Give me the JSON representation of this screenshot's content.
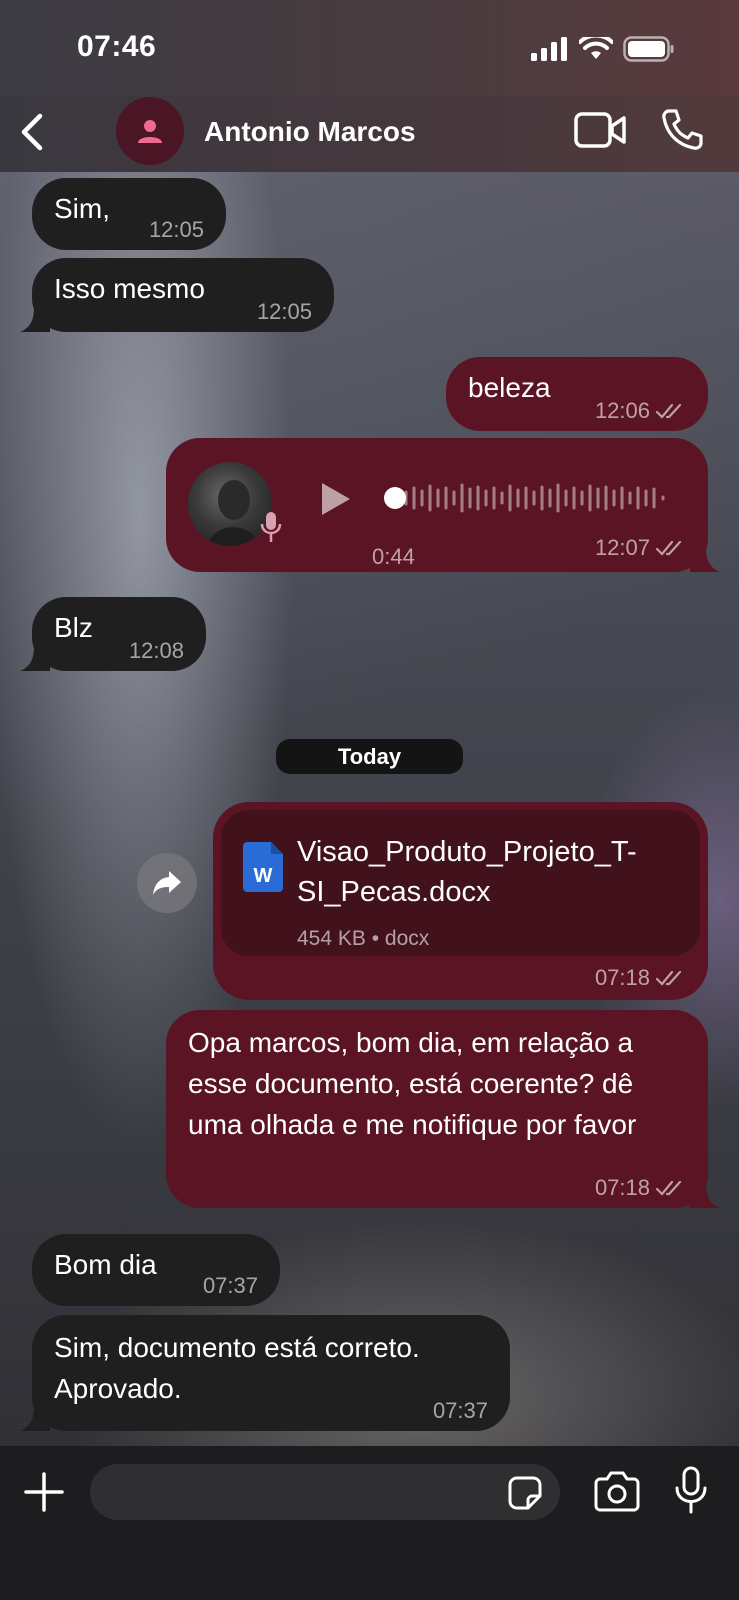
{
  "status_bar": {
    "time": "07:46"
  },
  "header": {
    "contact_name": "Antonio Marcos"
  },
  "messages": [
    {
      "text": "Sim,",
      "time": "12:05"
    },
    {
      "text": "Isso mesmo",
      "time": "12:05"
    },
    {
      "text": "beleza",
      "time": "12:06"
    },
    {
      "duration": "0:44",
      "time": "12:07"
    },
    {
      "text": "Blz",
      "time": "12:08"
    },
    {
      "file_name": "Visao_Produto_Projeto_T-SI_Pecas.docx",
      "file_info": "454 KB • docx",
      "time": "07:18"
    },
    {
      "text": "Opa marcos, bom dia, em relação a esse documento, está coerente? dê uma olhada e me notifique por favor",
      "time": "07:18"
    },
    {
      "text": "Bom dia",
      "time": "07:37"
    },
    {
      "text": "Sim, documento está correto. Aprovado.",
      "time": "07:37"
    }
  ],
  "date_separator": "Today",
  "colors": {
    "outgoing_bubble": "#5a1424",
    "incoming_bubble": "#1f1f20",
    "accent_pink": "#e85a8a",
    "word_blue": "#2b6bd6"
  },
  "icons": [
    "back-icon",
    "person-icon",
    "video-call-icon",
    "phone-icon",
    "play-icon",
    "mic-icon",
    "forward-icon",
    "word-doc-icon",
    "double-check-icon",
    "plus-icon",
    "sticker-icon",
    "camera-icon",
    "microphone-icon",
    "signal-icon",
    "wifi-icon",
    "battery-icon"
  ]
}
